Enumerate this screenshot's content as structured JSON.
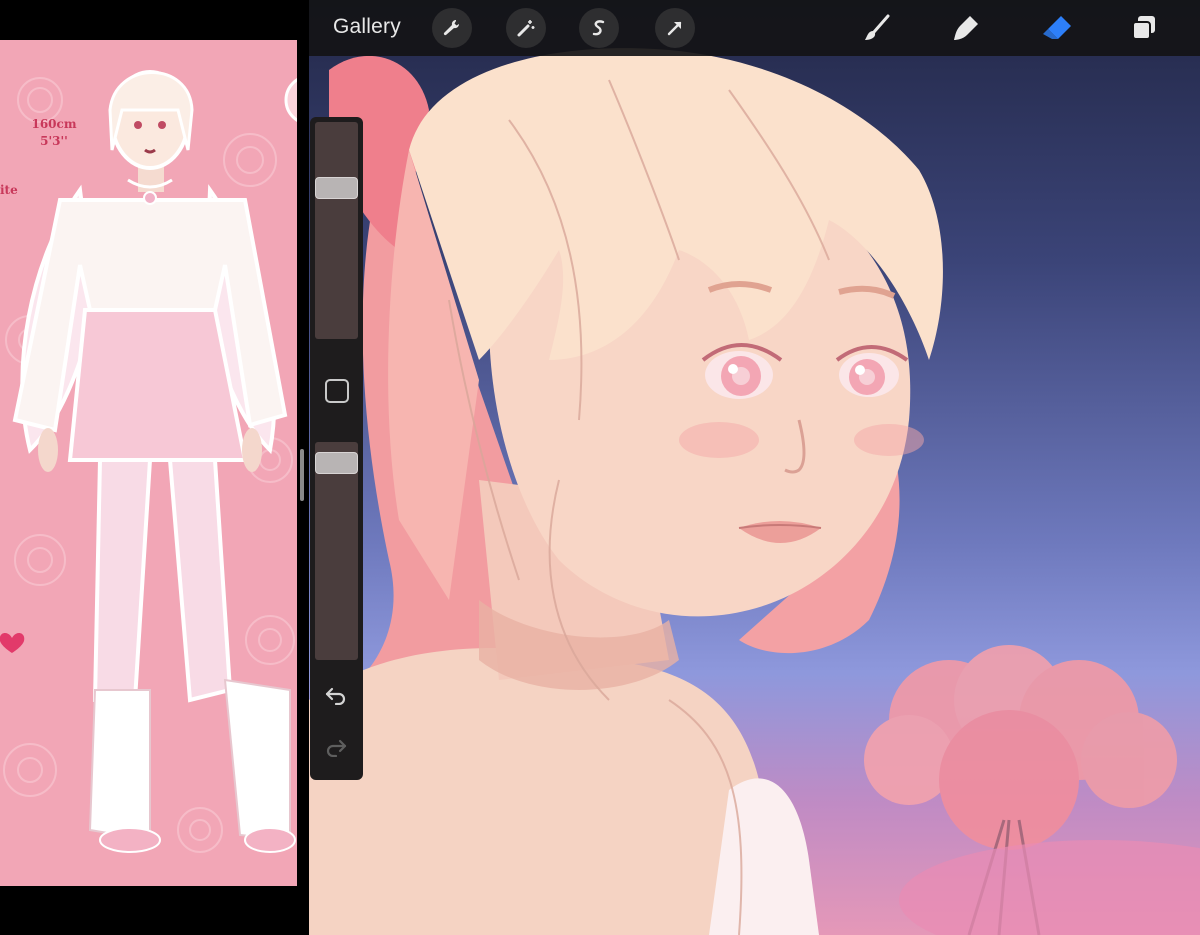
{
  "toolbar": {
    "gallery_label": "Gallery",
    "left_tools": [
      "wrench-icon",
      "magic-wand-icon",
      "selection-icon",
      "transform-arrow-icon"
    ],
    "right_tools": [
      "brush-icon",
      "smudge-icon",
      "eraser-icon",
      "layers-icon"
    ],
    "active_tool": "eraser",
    "active_color": "#2d7ff9"
  },
  "sidebar": {
    "brush_size": 0.72,
    "opacity": 0.95,
    "modify_icon": "square-icon",
    "undo_icon": "undo-icon",
    "redo_icon": "redo-icon"
  },
  "reference": {
    "height_cm": "160cm",
    "height_ft": "5'3''",
    "partial_text": "ite"
  },
  "colors": {
    "reference_background": "#f2a6b6",
    "canvas_top": "#232848",
    "canvas_bottom": "#e598b8",
    "skin": "#f7d2c2",
    "hair": "#f2a49e"
  }
}
